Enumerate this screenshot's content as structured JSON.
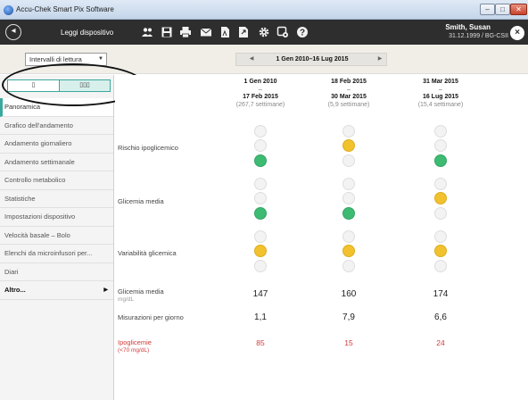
{
  "window": {
    "title": "Accu-Chek Smart Pix Software",
    "min": "–",
    "max": "□",
    "close": "✕"
  },
  "toolbar": {
    "read_label": "Leggi dispositivo",
    "user_name": "Smith, Susan",
    "user_sub": "31.12.1999 / BG-CSII",
    "icons": [
      "users-icon",
      "save-icon",
      "print-icon",
      "mail-icon",
      "pdf-export-icon",
      "export-icon",
      "gear-icon",
      "settings-icon",
      "help-icon"
    ]
  },
  "filter": {
    "select_value": "Intervalli di lettura",
    "date_range": "1 Gen 2010–16 Lug 2015"
  },
  "sidebar": {
    "toggle_left": "▯",
    "toggle_right": "▯▯▯",
    "items": [
      {
        "label": "Panoramica",
        "active": true
      },
      {
        "label": "Grafico dell'andamento"
      },
      {
        "label": "Andamento giornaliero"
      },
      {
        "label": "Andamento settimanale"
      },
      {
        "label": "Controllo metabolico"
      },
      {
        "label": "Statistiche"
      },
      {
        "label": "Impostazioni dispositivo"
      },
      {
        "label": "Velocità basale – Bolo"
      },
      {
        "label": "Elenchi da microinfusori per..."
      },
      {
        "label": "Diari"
      },
      {
        "label": "Altro..."
      }
    ]
  },
  "columns": [
    {
      "start": "1 Gen 2010",
      "dash": "–",
      "end": "17 Feb 2015",
      "weeks": "(267,7 settimane)"
    },
    {
      "start": "18 Feb 2015",
      "dash": "–",
      "end": "30 Mar 2015",
      "weeks": "(5,9 settimane)"
    },
    {
      "start": "31 Mar 2015",
      "dash": "–",
      "end": "16 Lug 2015",
      "weeks": "(15,4 settimane)"
    }
  ],
  "rows": {
    "risk": {
      "label": "Rischio ipoglicemico",
      "lights": [
        "green",
        "yellow",
        "green"
      ]
    },
    "avg": {
      "label": "Glicemia media",
      "lights": [
        "green",
        "green",
        "yellow"
      ]
    },
    "var": {
      "label": "Variabilità glicemica",
      "lights": [
        "yellow",
        "yellow",
        "yellow"
      ]
    },
    "avg_val": {
      "label": "Glicemia media",
      "unit": "mg/dL",
      "values": [
        "147",
        "160",
        "174"
      ]
    },
    "meas": {
      "label": "Misurazioni per giorno",
      "values": [
        "1,1",
        "7,9",
        "6,6"
      ]
    },
    "hypo": {
      "label": "Ipoglicemie",
      "unit": "(<70 mg/dL)",
      "values": [
        "85",
        "15",
        "24"
      ]
    }
  }
}
